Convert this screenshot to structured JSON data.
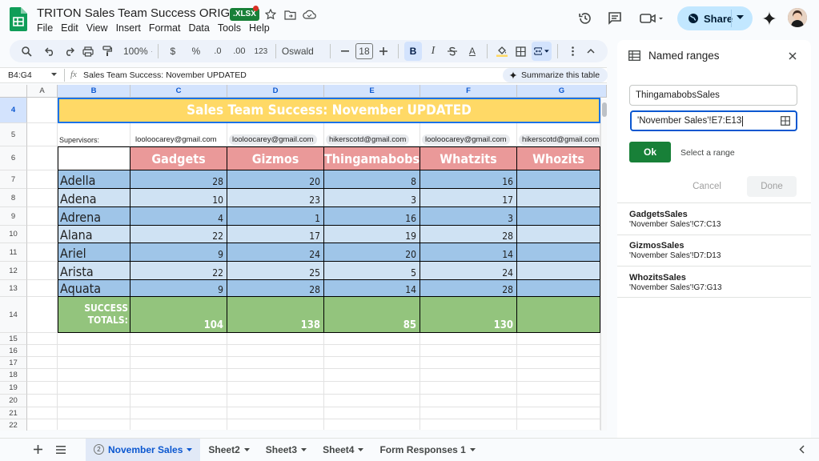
{
  "app": {
    "doc_title": "TRITON Sales Team Success ORIGINAL",
    "badge": ".XLSX",
    "menus": [
      "File",
      "Edit",
      "View",
      "Insert",
      "Format",
      "Data",
      "Tools",
      "Help"
    ],
    "share_label": "Share"
  },
  "toolbar": {
    "zoom": "100%",
    "currency": "$",
    "percent": "%",
    "dec_down": ".0",
    "dec_up": ".00",
    "number_format": "123",
    "font": "Oswald",
    "font_size": "18",
    "bold": "B",
    "italic": "I",
    "text_color": "A"
  },
  "formula_bar": {
    "name_box": "B4:G4",
    "fx": "fx",
    "content": "Sales Team Success: November UPDATED",
    "summarize": "Summarize this table"
  },
  "sheet": {
    "columns": [
      "A",
      "B",
      "C",
      "D",
      "E",
      "F",
      "G"
    ],
    "rows": [
      "4",
      "5",
      "6",
      "7",
      "8",
      "9",
      "10",
      "11",
      "12",
      "13",
      "14",
      "15",
      "16",
      "17",
      "18",
      "19",
      "20",
      "21",
      "22"
    ],
    "title": "Sales Team Success: November UPDATED",
    "supervisors_label": "Supervisors:",
    "emails": [
      "looloocarey@gmail.com",
      "looloocarey@gmail.com",
      "hikerscotd@gmail.com",
      "looloocarey@gmail.com",
      "hikerscotd@gmail.com"
    ],
    "products": [
      "Gadgets",
      "Gizmos",
      "Thingamabobs",
      "Whatzits",
      "Whozits"
    ],
    "people": [
      {
        "name": "Adella",
        "values": [
          "28",
          "20",
          "8",
          "16",
          ""
        ]
      },
      {
        "name": "Adena",
        "values": [
          "10",
          "23",
          "3",
          "17",
          ""
        ]
      },
      {
        "name": "Adrena",
        "values": [
          "4",
          "1",
          "16",
          "3",
          ""
        ]
      },
      {
        "name": "Alana",
        "values": [
          "22",
          "17",
          "19",
          "28",
          ""
        ]
      },
      {
        "name": "Ariel",
        "values": [
          "9",
          "24",
          "20",
          "14",
          ""
        ]
      },
      {
        "name": "Arista",
        "values": [
          "22",
          "25",
          "5",
          "24",
          ""
        ]
      },
      {
        "name": "Aquata",
        "values": [
          "9",
          "28",
          "14",
          "28",
          ""
        ]
      }
    ],
    "totals_label_1": "SUCCESS",
    "totals_label_2": "TOTALS:",
    "totals": [
      "104",
      "138",
      "85",
      "130",
      ""
    ]
  },
  "tabs": {
    "active_badge": "2",
    "active": "November Sales",
    "others": [
      "Sheet2",
      "Sheet3",
      "Sheet4",
      "Form Responses 1"
    ]
  },
  "panel": {
    "title": "Named ranges",
    "name_value": "ThingamabobsSales",
    "range_value": "'November Sales'!E7:E13",
    "ok": "Ok",
    "select_range": "Select a range",
    "cancel": "Cancel",
    "done": "Done",
    "ranges": [
      {
        "name": "GadgetsSales",
        "ref": "'November Sales'!C7:C13"
      },
      {
        "name": "GizmosSales",
        "ref": "'November Sales'!D7:D13"
      },
      {
        "name": "WhozitsSales",
        "ref": "'November Sales'!G7:G13"
      }
    ]
  },
  "colors": {
    "title_bg": "#ffd966",
    "title_text": "#ffffff",
    "header_bg": "#ea9999",
    "name_dark": "#9fc5e8",
    "name_light": "#cfe2f3",
    "totals_bg": "#93c47d",
    "accent": "#0b57d0",
    "ok_green": "#188038"
  }
}
